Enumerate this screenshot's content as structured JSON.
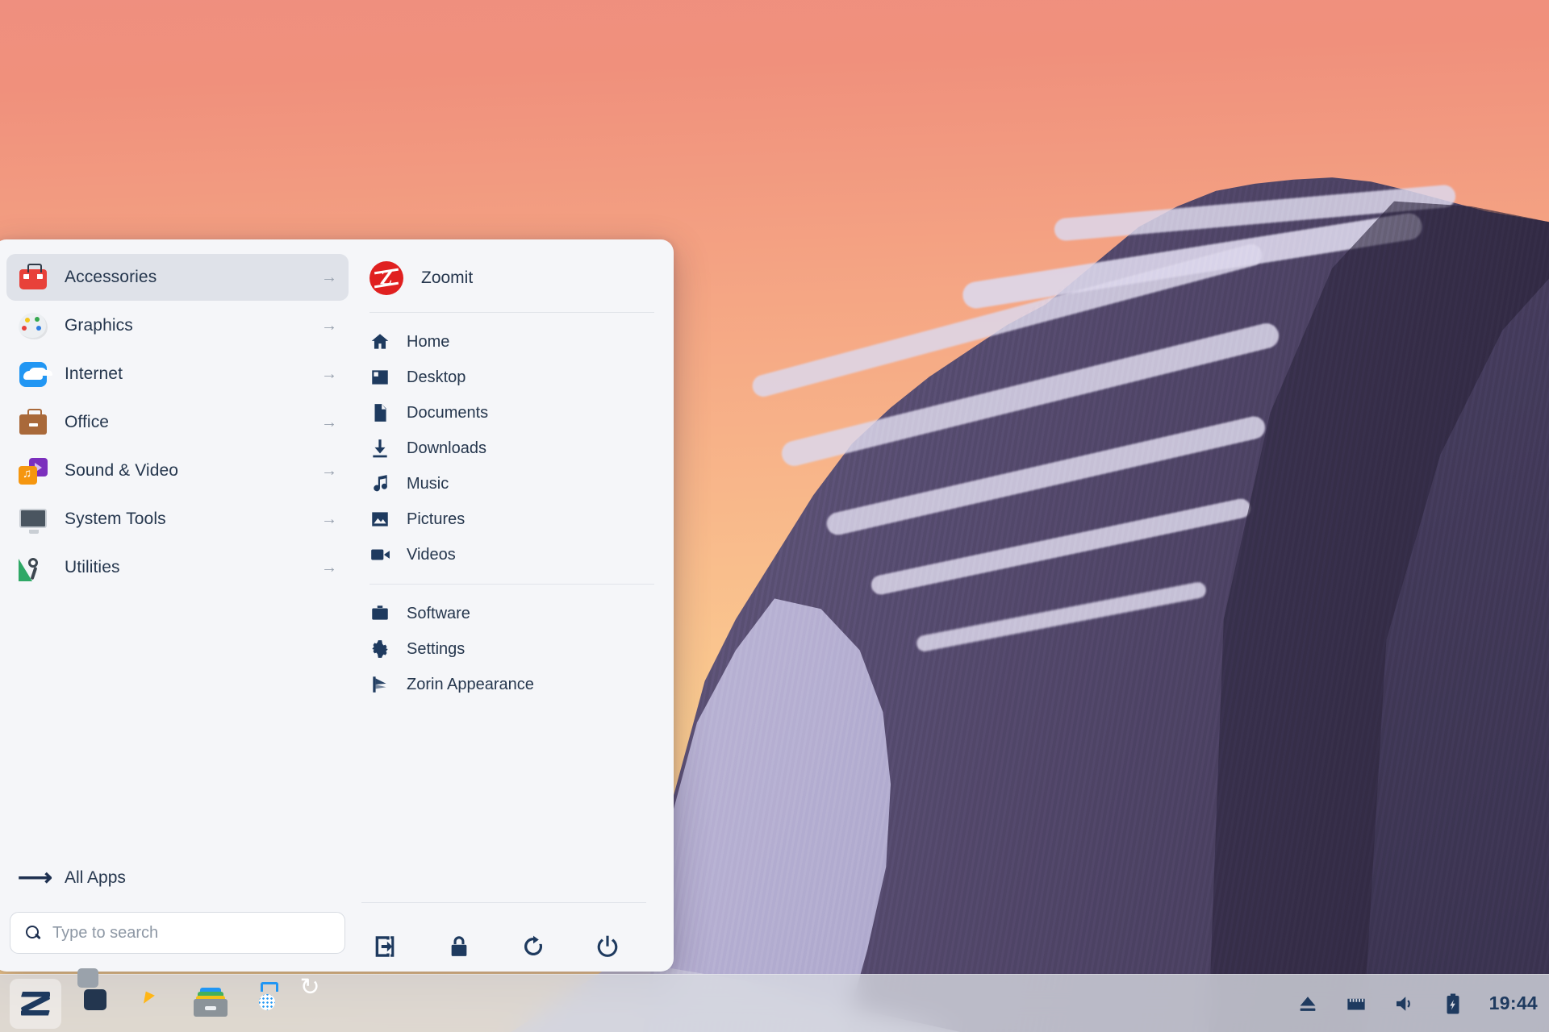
{
  "desktop": {
    "wallpaper_name": "sunset-mountain",
    "sky_top_color": "#ef8f7f",
    "sky_bottom_color": "#fbdca4",
    "mountain_color": "#5c5278",
    "snow_color": "#d6d2e6"
  },
  "app_menu": {
    "categories": [
      {
        "label": "Accessories",
        "icon": "toolbox-icon",
        "arrow": "→",
        "selected": true
      },
      {
        "label": "Graphics",
        "icon": "palette-icon",
        "arrow": "→",
        "selected": false
      },
      {
        "label": "Internet",
        "icon": "cloud-icon",
        "arrow": "→",
        "selected": false
      },
      {
        "label": "Office",
        "icon": "briefcase-icon",
        "arrow": "→",
        "selected": false
      },
      {
        "label": "Sound & Video",
        "icon": "media-icon",
        "arrow": "→",
        "selected": false
      },
      {
        "label": "System Tools",
        "icon": "monitor-icon",
        "arrow": "→",
        "selected": false
      },
      {
        "label": "Utilities",
        "icon": "utilities-icon",
        "arrow": "→",
        "selected": false
      }
    ],
    "all_apps": {
      "label": "All Apps",
      "icon": "arrow-right-icon"
    },
    "search": {
      "placeholder": "Type to search",
      "value": "",
      "icon": "search-icon"
    },
    "favourite_app": {
      "label": "Zoomit",
      "logo_letter": "Z",
      "logo_color": "#e02020"
    },
    "places": [
      {
        "label": "Home",
        "icon": "home-icon"
      },
      {
        "label": "Desktop",
        "icon": "desktop-icon"
      },
      {
        "label": "Documents",
        "icon": "documents-icon"
      },
      {
        "label": "Downloads",
        "icon": "download-icon"
      },
      {
        "label": "Music",
        "icon": "music-note-icon"
      },
      {
        "label": "Pictures",
        "icon": "picture-icon"
      },
      {
        "label": "Videos",
        "icon": "video-camera-icon"
      }
    ],
    "system_items": [
      {
        "label": "Software",
        "icon": "briefcase-icon"
      },
      {
        "label": "Settings",
        "icon": "gear-icon"
      },
      {
        "label": "Zorin Appearance",
        "icon": "zorin-appearance-icon"
      }
    ],
    "session_actions": [
      {
        "name": "log-out-button",
        "icon": "logout-icon"
      },
      {
        "name": "lock-button",
        "icon": "lock-icon"
      },
      {
        "name": "restart-button",
        "icon": "restart-icon"
      },
      {
        "name": "power-button",
        "icon": "power-icon"
      }
    ]
  },
  "taskbar": {
    "launchers": [
      {
        "name": "zorin-menu-button",
        "icon": "zorin-logo-icon",
        "active": true
      },
      {
        "name": "workspace-switcher-button",
        "icon": "workspace-switcher-icon",
        "active": false
      },
      {
        "name": "firefox-button",
        "icon": "firefox-icon",
        "active": false
      },
      {
        "name": "files-button",
        "icon": "file-manager-icon",
        "active": false
      },
      {
        "name": "software-store-button",
        "icon": "software-store-icon",
        "active": false
      },
      {
        "name": "software-updater-button",
        "icon": "software-updater-icon",
        "active": false
      }
    ],
    "tray": [
      {
        "name": "eject-button",
        "icon": "eject-icon"
      },
      {
        "name": "network-button",
        "icon": "ethernet-icon"
      },
      {
        "name": "volume-button",
        "icon": "volume-icon"
      },
      {
        "name": "battery-button",
        "icon": "battery-charging-icon"
      }
    ],
    "clock": "19:44"
  }
}
